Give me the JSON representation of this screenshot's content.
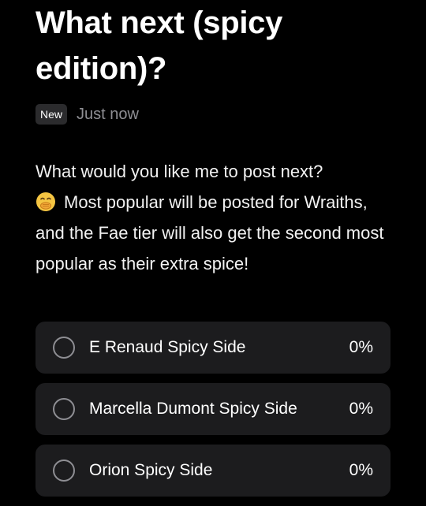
{
  "post": {
    "title": "What next (spicy edition)?",
    "badge": "New",
    "timestamp": "Just now",
    "body_line1": "What would you like me to post next?",
    "body_rest": "Most popular will be posted for Wraiths, and the Fae tier will also get the second most popular as their extra spice!",
    "emoji_icon": "hand-over-mouth-emoji"
  },
  "poll": {
    "options": [
      {
        "label": "E Renaud Spicy Side",
        "percent": "0%"
      },
      {
        "label": "Marcella Dumont Spicy Side",
        "percent": "0%"
      },
      {
        "label": "Orion Spicy Side",
        "percent": "0%"
      }
    ]
  },
  "colors": {
    "background": "#000000",
    "card": "#1c1c1e",
    "muted": "#8e8e93",
    "badge": "#2b2b2d",
    "emoji": "#f5c542"
  }
}
